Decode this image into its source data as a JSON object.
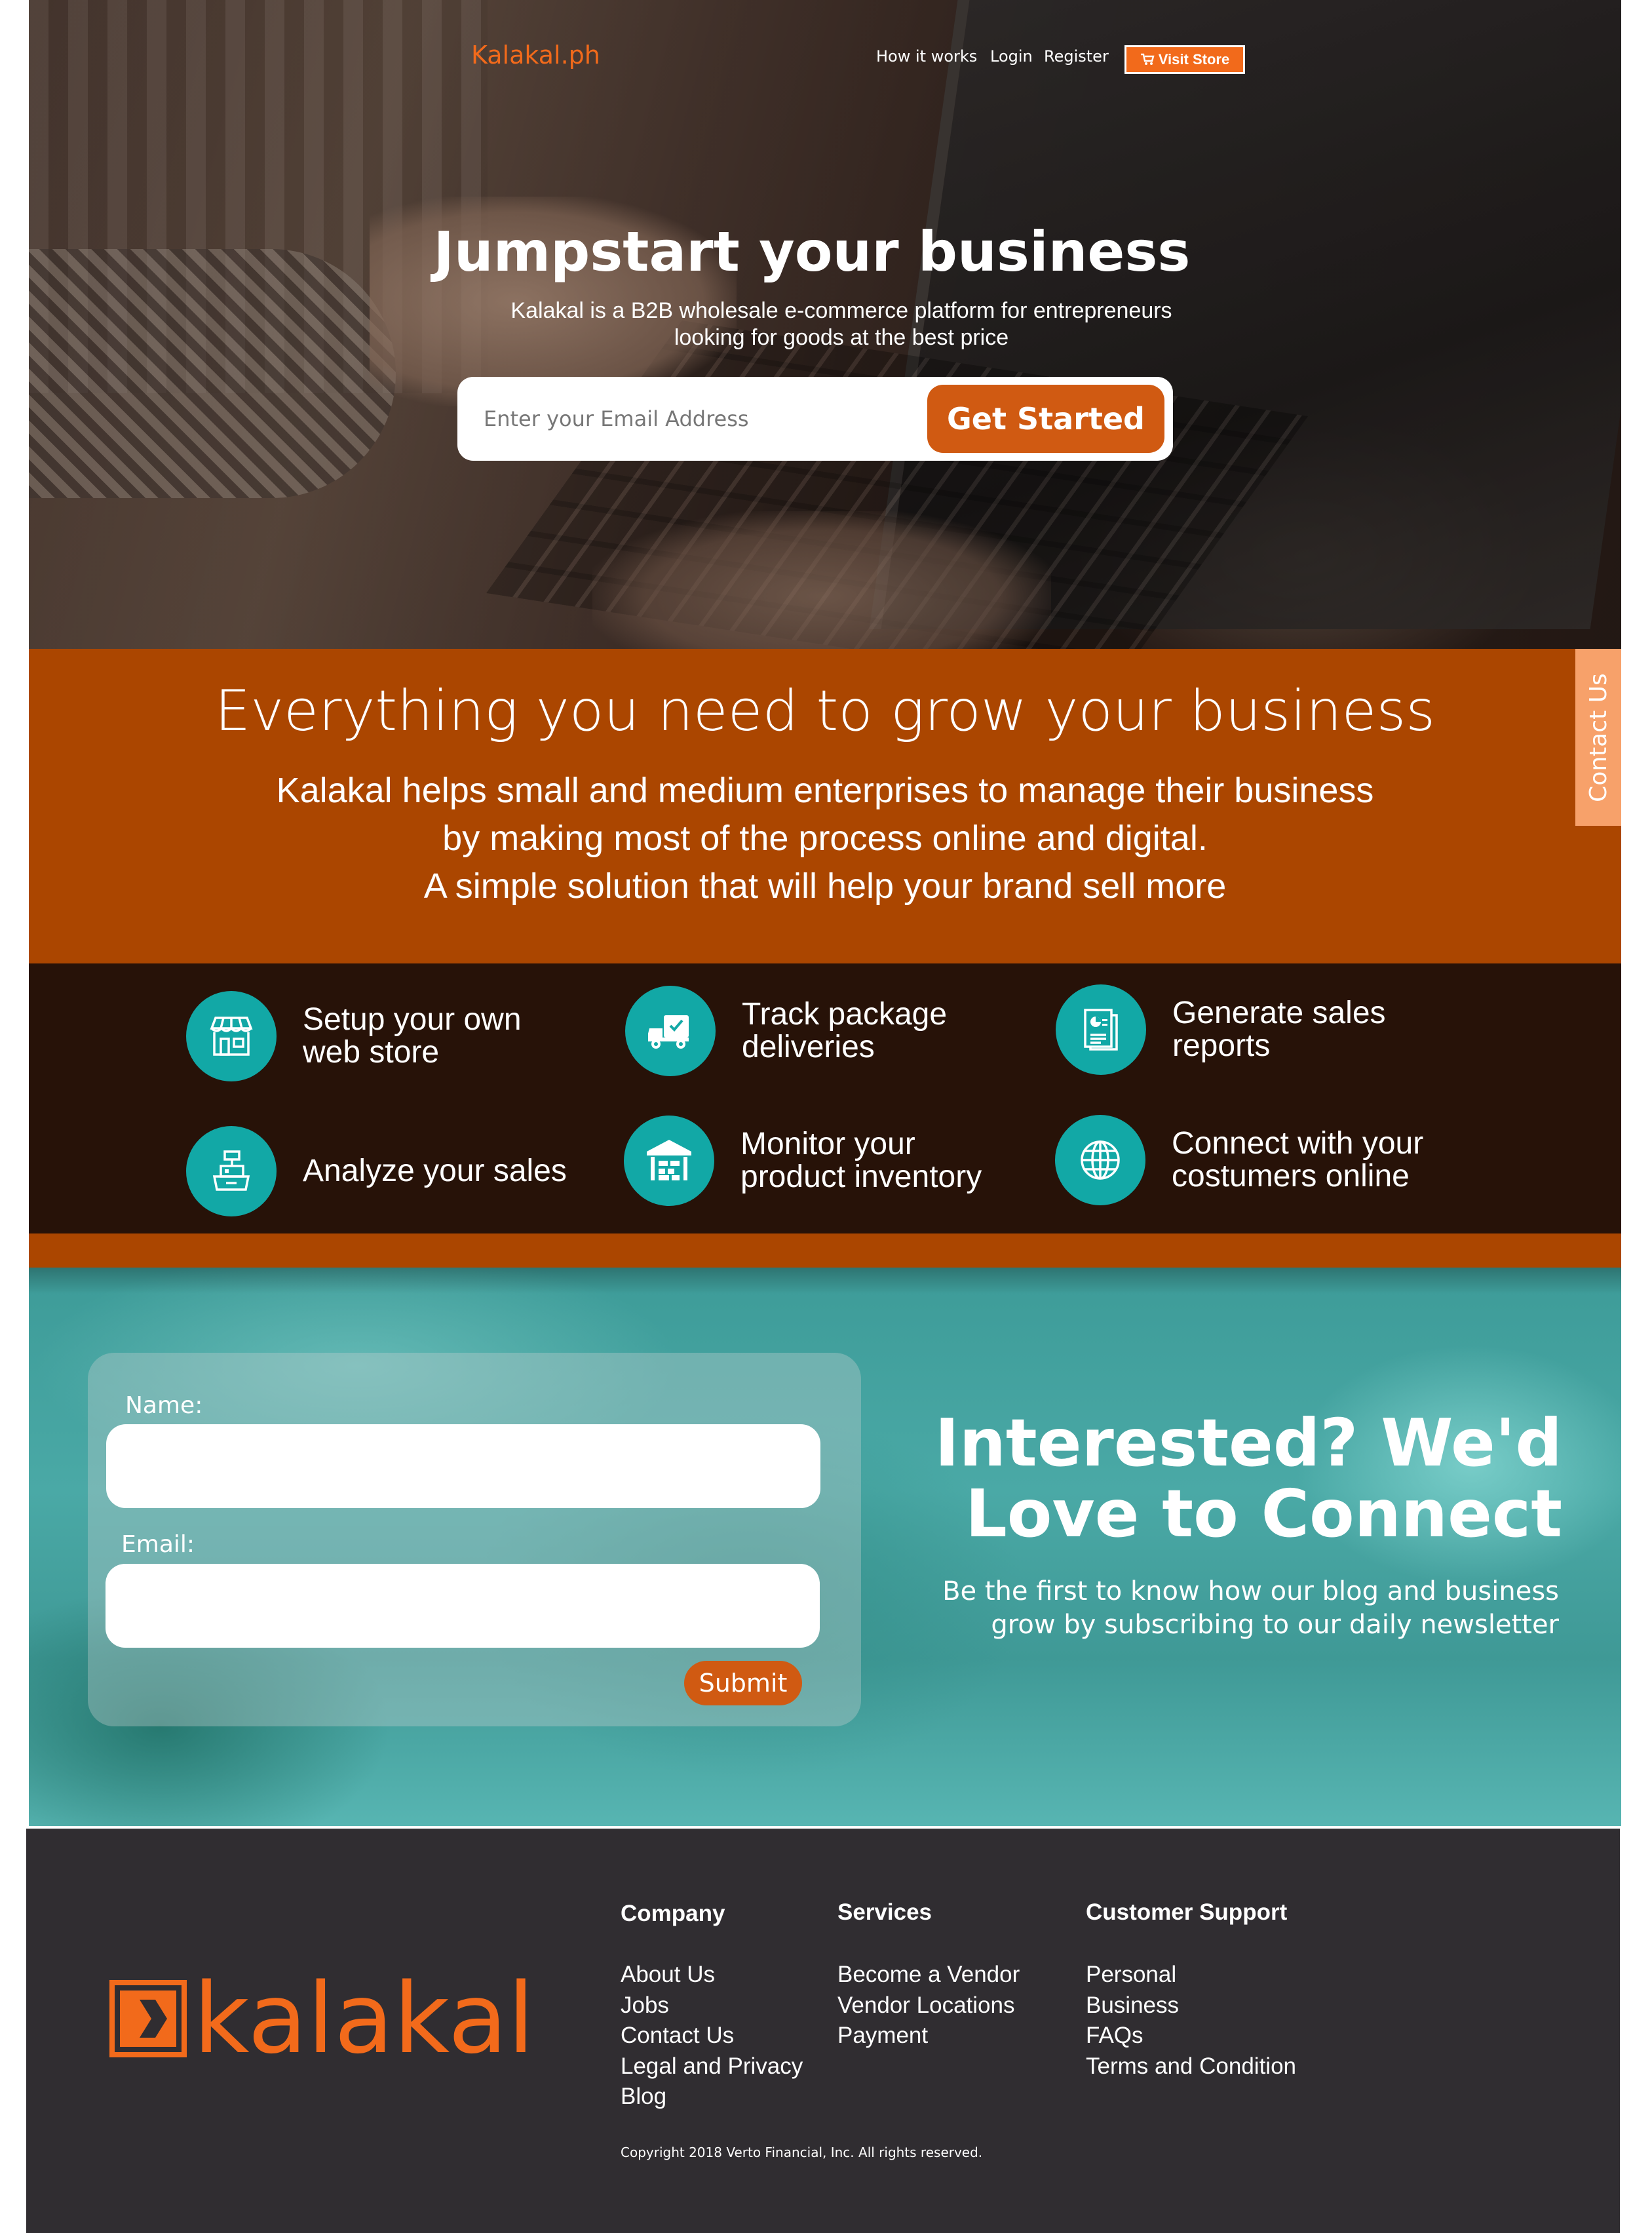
{
  "header": {
    "brand": "Kalakal.ph",
    "nav": [
      "How it works",
      "Login",
      "Register"
    ],
    "visit_store": "Visit Store"
  },
  "hero": {
    "title": "Jumpstart your business",
    "subtitle_line1": "Kalakal is a B2B wholesale e-commerce platform for entrepreneurs",
    "subtitle_line2": "looking for goods at the best price",
    "email_placeholder": "Enter your Email Address",
    "cta": "Get Started"
  },
  "grow": {
    "title": "Everything you need to grow your business",
    "lines": [
      "Kalakal helps small and medium enterprises to manage their business",
      "by making most of the process online and digital.",
      "A simple solution that will help your brand sell more"
    ]
  },
  "contact_tab": "Contact Us",
  "features": [
    {
      "icon": "store-icon",
      "line1": "Setup your own",
      "line2": "web store"
    },
    {
      "icon": "delivery-truck-icon",
      "line1": "Track package",
      "line2": "deliveries"
    },
    {
      "icon": "report-icon",
      "line1": "Generate sales",
      "line2": "reports"
    },
    {
      "icon": "cash-register-icon",
      "line1": "Analyze your sales",
      "line2": ""
    },
    {
      "icon": "warehouse-icon",
      "line1": "Monitor your",
      "line2": "product inventory"
    },
    {
      "icon": "globe-icon",
      "line1": "Connect with your",
      "line2": "costumers online"
    }
  ],
  "connect": {
    "name_label": "Name:",
    "email_label": "Email:",
    "submit": "Submit",
    "title_line1": "Interested? We'd",
    "title_line2": "Love to Connect",
    "sub_line1": "Be the first to know how our blog and business",
    "sub_line2": "grow by subscribing to our daily newsletter"
  },
  "footer": {
    "logo_text": "kalakal",
    "columns": [
      {
        "heading": "Company",
        "items": [
          "About Us",
          "Jobs",
          "Contact Us",
          "Legal and Privacy",
          "Blog"
        ]
      },
      {
        "heading": "Services",
        "items": [
          "Become a Vendor",
          "Vendor Locations",
          "Payment"
        ]
      },
      {
        "heading": "Customer Support",
        "items": [
          "Personal",
          "Business",
          "FAQs",
          "Terms and Condition"
        ]
      }
    ],
    "copyright": "Copyright 2018 Verto Financial, Inc. All rights reserved."
  },
  "colors": {
    "accent": "#f26a1b",
    "section_orange": "#ab4600",
    "teal": "#12a8a6",
    "dark": "#271208",
    "footer": "#302d31"
  }
}
